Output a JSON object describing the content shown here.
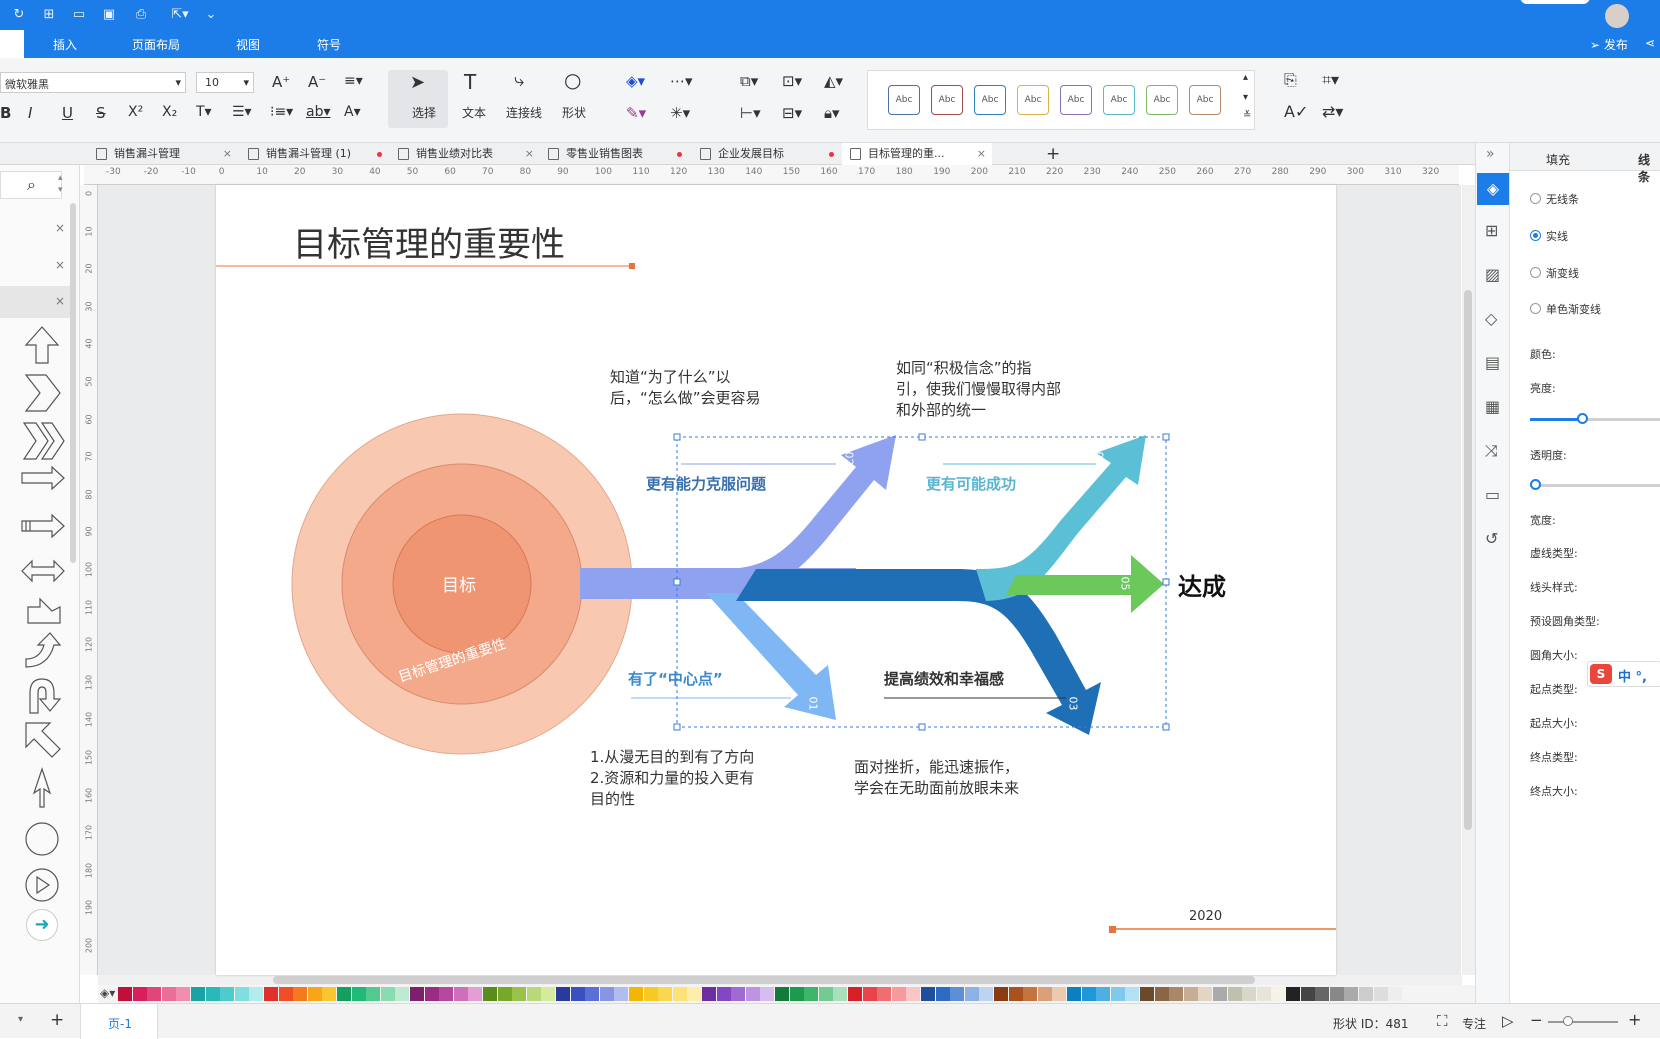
{
  "menu": {
    "insert": "插入",
    "page_layout": "页面布局",
    "view": "视图",
    "symbol": "符号",
    "publish": "发布"
  },
  "ribbon": {
    "font_name": "微软雅黑",
    "font_size": "10",
    "select": "选择",
    "text": "文本",
    "connector": "连接线",
    "shape": "形状",
    "style_label": "Abc"
  },
  "tabs": [
    {
      "label": "销售漏斗管理",
      "state": "close"
    },
    {
      "label": "销售漏斗管理 (1)",
      "state": "modified"
    },
    {
      "label": "销售业绩对比表",
      "state": "close"
    },
    {
      "label": "零售业销售图表",
      "state": "modified"
    },
    {
      "label": "企业发展目标",
      "state": "modified"
    },
    {
      "label": "目标管理的重...",
      "state": "close"
    }
  ],
  "ruler_h": [
    "-30",
    "-20",
    "-10",
    "0",
    "10",
    "20",
    "30",
    "40",
    "50",
    "60",
    "70",
    "80",
    "90",
    "100",
    "110",
    "120",
    "130",
    "140",
    "150",
    "160",
    "170",
    "180",
    "190",
    "200",
    "210",
    "220",
    "230",
    "240",
    "250",
    "260",
    "270",
    "280",
    "290",
    "300",
    "310",
    "320"
  ],
  "ruler_v": [
    "0",
    "10",
    "20",
    "30",
    "40",
    "50",
    "60",
    "70",
    "80",
    "90",
    "100",
    "110",
    "120",
    "130",
    "140",
    "150",
    "160",
    "170",
    "180",
    "190",
    "200"
  ],
  "diagram": {
    "title": "目标管理的重要性",
    "center": "目标",
    "ring_text": "目标管理的重要性",
    "branch1": "更有能力克服问题",
    "branch2": "更有可能成功",
    "branch3": "有了“中心点”",
    "branch4": "提高绩效和幸福感",
    "goal": "达成",
    "n01": "01",
    "n02": "02",
    "n03": "03",
    "n04": "04",
    "n05": "05",
    "note1_l1": "知道“为了什么”以",
    "note1_l2": "后，“怎么做”会更容易",
    "note2_l1": "如同“积极信念”的指",
    "note2_l2": "引，使我们慢慢取得内部",
    "note2_l3": "和外部的统一",
    "note3_l1": "1.从漫无目的到有了方向",
    "note3_l2": "2.资源和力量的投入更有",
    "note3_l3": "目的性",
    "note4_l1": "面对挫折，能迅速振作，",
    "note4_l2": "学会在无助面前放眼未来",
    "year": "2020",
    "colors": {
      "ring_outer": "#f8c8b0",
      "ring_mid": "#f4a98a",
      "ring_inner": "#f09572",
      "blue1": "#8ea2f0",
      "blue2": "#1f6fb6",
      "cyan": "#5bc0d6",
      "green": "#6ac95a",
      "lightblue": "#7fb7f5",
      "accent": "#e8743b"
    }
  },
  "props": {
    "tab_fill": "填充",
    "tab_line": "线条",
    "no_line": "无线条",
    "solid": "实线",
    "gradient": "渐变线",
    "mono_gradient": "单色渐变线",
    "color": "颜色:",
    "brightness": "亮度:",
    "transparency": "透明度:",
    "width": "宽度:",
    "dash": "虚线类型:",
    "cap": "线头样式:",
    "preset_corner": "预设圆角类型:",
    "corner_size": "圆角大小:",
    "start_type": "起点类型:",
    "start_size": "起点大小:",
    "end_type": "终点类型:",
    "end_size": "终点大小:"
  },
  "status": {
    "page": "页-1",
    "shape_id": "形状 ID：481",
    "focus": "专注"
  }
}
